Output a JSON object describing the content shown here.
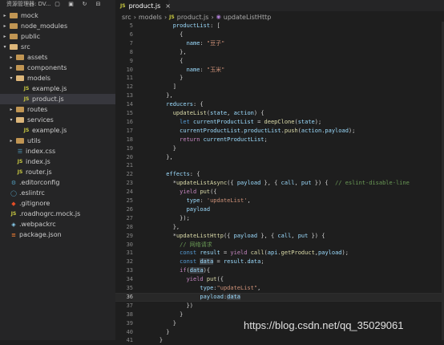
{
  "explorer": {
    "title": "资源管理器: DV...",
    "items": [
      {
        "label": "mock",
        "type": "folder",
        "depth": 0,
        "open": false,
        "icon": "folder-icon"
      },
      {
        "label": "node_modules",
        "type": "folder",
        "depth": 0,
        "open": false,
        "icon": "folder-icon"
      },
      {
        "label": "public",
        "type": "folder",
        "depth": 0,
        "open": false,
        "icon": "folder-icon"
      },
      {
        "label": "src",
        "type": "folder",
        "depth": 0,
        "open": true,
        "icon": "folder-icon"
      },
      {
        "label": "assets",
        "type": "folder",
        "depth": 1,
        "open": false,
        "icon": "folder-icon"
      },
      {
        "label": "components",
        "type": "folder",
        "depth": 1,
        "open": false,
        "icon": "folder-icon"
      },
      {
        "label": "models",
        "type": "folder",
        "depth": 1,
        "open": true,
        "icon": "folder-icon"
      },
      {
        "label": "example.js",
        "type": "js",
        "depth": 2
      },
      {
        "label": "product.js",
        "type": "js",
        "depth": 2,
        "selected": true
      },
      {
        "label": "routes",
        "type": "folder",
        "depth": 1,
        "open": false,
        "icon": "folder-icon"
      },
      {
        "label": "services",
        "type": "folder",
        "depth": 1,
        "open": true,
        "icon": "folder-icon"
      },
      {
        "label": "example.js",
        "type": "js",
        "depth": 2
      },
      {
        "label": "utils",
        "type": "folder",
        "depth": 1,
        "open": false,
        "icon": "folder-icon"
      },
      {
        "label": "index.css",
        "type": "css",
        "depth": 1
      },
      {
        "label": "index.js",
        "type": "js",
        "depth": 1
      },
      {
        "label": "router.js",
        "type": "js",
        "depth": 1
      },
      {
        "label": ".editorconfig",
        "type": "cfg",
        "depth": 0
      },
      {
        "label": ".eslintrc",
        "type": "cfg2",
        "depth": 0
      },
      {
        "label": ".gitignore",
        "type": "git",
        "depth": 0
      },
      {
        "label": ".roadhogrc.mock.js",
        "type": "js",
        "depth": 0
      },
      {
        "label": ".webpackrc",
        "type": "wp",
        "depth": 0
      },
      {
        "label": "package.json",
        "type": "pkg",
        "depth": 0
      }
    ]
  },
  "tab": {
    "label": "product.js",
    "js_badge": "JS",
    "close": "×"
  },
  "breadcrumb": {
    "parts": [
      "src",
      "›",
      "models",
      "›"
    ],
    "js_badge": "JS",
    "file": "product.js",
    "sep": "›",
    "fn_icon": "◉",
    "fn": "updateListHttp"
  },
  "code": [
    {
      "n": "5",
      "t": [
        [
          "prop",
          "        productList"
        ],
        [
          "pl",
          ": ["
        ]
      ]
    },
    {
      "n": "6",
      "t": [
        [
          "pl",
          "          {"
        ]
      ]
    },
    {
      "n": "7",
      "t": [
        [
          "prop",
          "            name"
        ],
        [
          "pl",
          ": "
        ],
        [
          "str",
          "\"豆子\""
        ]
      ]
    },
    {
      "n": "8",
      "t": [
        [
          "pl",
          "          },"
        ]
      ]
    },
    {
      "n": "9",
      "t": [
        [
          "pl",
          "          {"
        ]
      ]
    },
    {
      "n": "10",
      "t": [
        [
          "prop",
          "            name"
        ],
        [
          "pl",
          ": "
        ],
        [
          "str",
          "\"玉米\""
        ]
      ]
    },
    {
      "n": "11",
      "t": [
        [
          "pl",
          "          }"
        ]
      ]
    },
    {
      "n": "12",
      "t": [
        [
          "pl",
          "        ]"
        ]
      ]
    },
    {
      "n": "13",
      "t": [
        [
          "pl",
          "      },"
        ]
      ]
    },
    {
      "n": "14",
      "t": [
        [
          "prop",
          "      reducers"
        ],
        [
          "pl",
          ": {"
        ]
      ]
    },
    {
      "n": "15",
      "t": [
        [
          "fn",
          "        updateList"
        ],
        [
          "pl",
          "("
        ],
        [
          "var",
          "state"
        ],
        [
          "pl",
          ", "
        ],
        [
          "var",
          "action"
        ],
        [
          "pl",
          ") {"
        ]
      ]
    },
    {
      "n": "16",
      "t": [
        [
          "kw",
          "          let "
        ],
        [
          "var",
          "currentProductList"
        ],
        [
          "pl",
          " = "
        ],
        [
          "fn",
          "deepClone"
        ],
        [
          "pl",
          "("
        ],
        [
          "var",
          "state"
        ],
        [
          "pl",
          ");"
        ]
      ]
    },
    {
      "n": "17",
      "t": [
        [
          "var",
          "          currentProductList"
        ],
        [
          "pl",
          "."
        ],
        [
          "var",
          "productList"
        ],
        [
          "pl",
          "."
        ],
        [
          "fn",
          "push"
        ],
        [
          "pl",
          "("
        ],
        [
          "var",
          "action"
        ],
        [
          "pl",
          "."
        ],
        [
          "var",
          "payload"
        ],
        [
          "pl",
          ");"
        ]
      ]
    },
    {
      "n": "18",
      "t": [
        [
          "ctl",
          "          return "
        ],
        [
          "var",
          "currentProductList"
        ],
        [
          "pl",
          ";"
        ]
      ]
    },
    {
      "n": "19",
      "t": [
        [
          "pl",
          "        }"
        ]
      ]
    },
    {
      "n": "20",
      "t": [
        [
          "pl",
          "      },"
        ]
      ]
    },
    {
      "n": "21",
      "t": [
        [
          "pl",
          ""
        ]
      ]
    },
    {
      "n": "22",
      "t": [
        [
          "prop",
          "      effects"
        ],
        [
          "pl",
          ": {"
        ]
      ]
    },
    {
      "n": "23",
      "t": [
        [
          "pl",
          "        *"
        ],
        [
          "fn",
          "updateListAsync"
        ],
        [
          "pl",
          "({ "
        ],
        [
          "var",
          "payload"
        ],
        [
          "pl",
          " }, { "
        ],
        [
          "var",
          "call"
        ],
        [
          "pl",
          ", "
        ],
        [
          "var",
          "put"
        ],
        [
          "pl",
          " }) {  "
        ],
        [
          "cmt",
          "// eslint-disable-line"
        ]
      ]
    },
    {
      "n": "24",
      "t": [
        [
          "ctl",
          "          yield "
        ],
        [
          "fn",
          "put"
        ],
        [
          "pl",
          "({"
        ]
      ]
    },
    {
      "n": "25",
      "t": [
        [
          "prop",
          "            type"
        ],
        [
          "pl",
          ": "
        ],
        [
          "str",
          "'updateList'"
        ],
        [
          "pl",
          ","
        ]
      ]
    },
    {
      "n": "26",
      "t": [
        [
          "var",
          "            payload"
        ]
      ]
    },
    {
      "n": "27",
      "t": [
        [
          "pl",
          "          });"
        ]
      ]
    },
    {
      "n": "28",
      "t": [
        [
          "pl",
          "        },"
        ]
      ]
    },
    {
      "n": "29",
      "t": [
        [
          "pl",
          "        *"
        ],
        [
          "fn",
          "updateListHttp"
        ],
        [
          "pl",
          "({ "
        ],
        [
          "var",
          "payload"
        ],
        [
          "pl",
          " }, { "
        ],
        [
          "var",
          "call"
        ],
        [
          "pl",
          ", "
        ],
        [
          "var",
          "put"
        ],
        [
          "pl",
          " }) {"
        ]
      ]
    },
    {
      "n": "30",
      "t": [
        [
          "cmt",
          "          // 网络请求"
        ]
      ]
    },
    {
      "n": "31",
      "t": [
        [
          "kw",
          "          const "
        ],
        [
          "var",
          "result"
        ],
        [
          "pl",
          " = "
        ],
        [
          "ctl",
          "yield "
        ],
        [
          "fn",
          "call"
        ],
        [
          "pl",
          "("
        ],
        [
          "var",
          "api"
        ],
        [
          "pl",
          "."
        ],
        [
          "fn",
          "getProduct"
        ],
        [
          "pl",
          ","
        ],
        [
          "var",
          "payload"
        ],
        [
          "pl",
          ");"
        ]
      ]
    },
    {
      "n": "32",
      "t": [
        [
          "kw",
          "          const "
        ],
        [
          "var",
          "data",
          "hl"
        ],
        [
          "pl",
          " = "
        ],
        [
          "var",
          "result"
        ],
        [
          "pl",
          "."
        ],
        [
          "var",
          "data"
        ],
        [
          "pl",
          ";"
        ]
      ]
    },
    {
      "n": "33",
      "t": [
        [
          "ctl",
          "          if"
        ],
        [
          "pl",
          "("
        ],
        [
          "var",
          "data",
          "hl"
        ],
        [
          "pl",
          "){"
        ]
      ]
    },
    {
      "n": "34",
      "t": [
        [
          "ctl",
          "            yield "
        ],
        [
          "fn",
          "put"
        ],
        [
          "pl",
          "({"
        ]
      ]
    },
    {
      "n": "35",
      "t": [
        [
          "prop",
          "                type"
        ],
        [
          "pl",
          ":"
        ],
        [
          "str",
          "\"updateList\""
        ],
        [
          "pl",
          ","
        ]
      ]
    },
    {
      "n": "36",
      "t": [
        [
          "prop",
          "                payload"
        ],
        [
          "pl",
          ":"
        ],
        [
          "var",
          "data",
          "hl"
        ]
      ],
      "current": true
    },
    {
      "n": "37",
      "t": [
        [
          "pl",
          "            })"
        ]
      ]
    },
    {
      "n": "38",
      "t": [
        [
          "pl",
          "          }"
        ]
      ]
    },
    {
      "n": "39",
      "t": [
        [
          "pl",
          "        }"
        ]
      ]
    },
    {
      "n": "40",
      "t": [
        [
          "pl",
          "      }"
        ]
      ]
    },
    {
      "n": "41",
      "t": [
        [
          "pl",
          "    }"
        ]
      ]
    }
  ],
  "watermark": "https://blog.csdn.net/qq_35029061",
  "colors": {
    "folder": "#c09553",
    "js": "#cbcb41",
    "keyword": "#569cd6",
    "string": "#ce9178",
    "function": "#dcdcaa",
    "comment": "#6a9955"
  }
}
